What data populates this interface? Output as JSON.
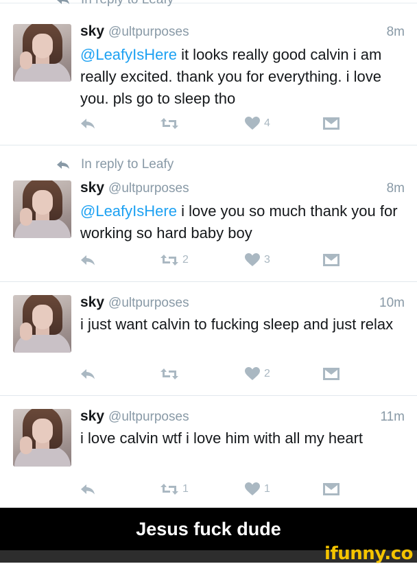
{
  "colors": {
    "mention": "#1da1f2",
    "muted": "#8899a6",
    "icon": "#aab8c2",
    "banner_bg": "#000000",
    "logo": "#f5c400"
  },
  "tweets": [
    {
      "reply_context": "In reply to Leafy",
      "name": "sky",
      "handle": "@ultpurposes",
      "time": "8m",
      "mention": "@LeafyIsHere",
      "text": " it looks really good calvin i am really excited. thank you for everything. i love you. pls go to sleep tho",
      "retweets": "",
      "likes": "4"
    },
    {
      "reply_context": "In reply to Leafy",
      "name": "sky",
      "handle": "@ultpurposes",
      "time": "8m",
      "mention": "@LeafyIsHere",
      "text": " i love you so much thank you for working so hard baby boy",
      "retweets": "2",
      "likes": "3"
    },
    {
      "name": "sky",
      "handle": "@ultpurposes",
      "time": "10m",
      "text": "i just want calvin to fucking sleep and just relax",
      "retweets": "",
      "likes": "2"
    },
    {
      "name": "sky",
      "handle": "@ultpurposes",
      "time": "11m",
      "text": "i love calvin wtf i love him with all my heart",
      "retweets": "1",
      "likes": "1"
    }
  ],
  "icons": [
    "reply-icon",
    "retweet-icon",
    "like-icon",
    "direct-message-icon"
  ],
  "caption": "Jesus fuck dude",
  "watermark": "ifunny.co"
}
